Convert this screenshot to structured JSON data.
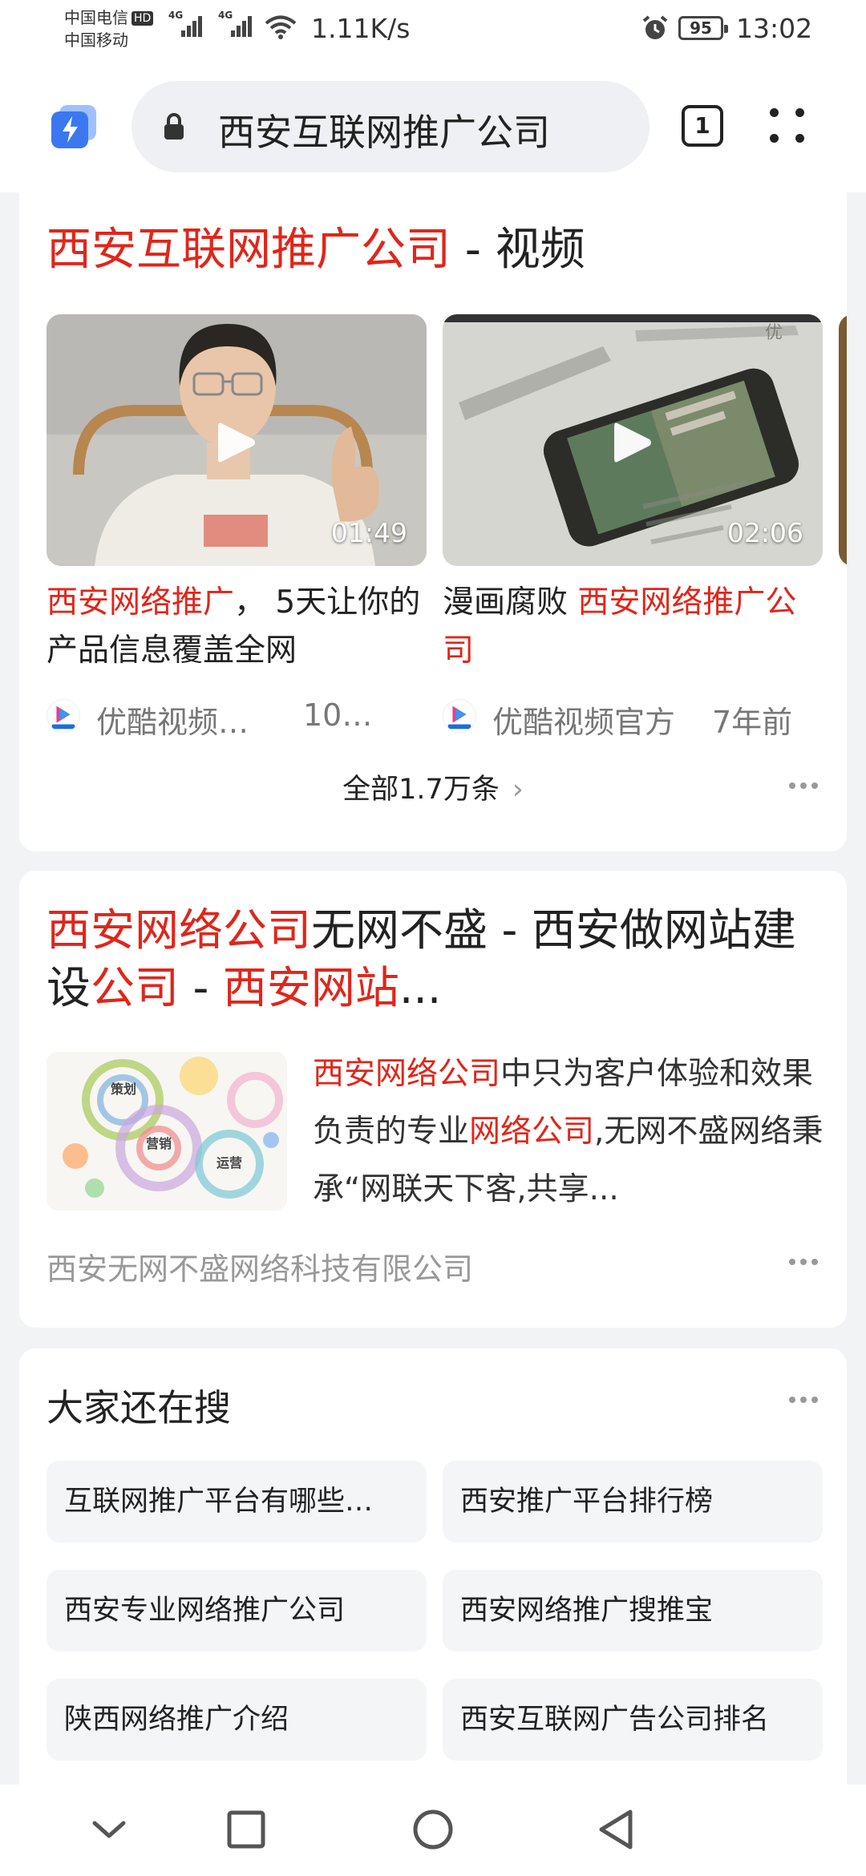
{
  "status": {
    "carrier1": "中国电信",
    "hd": "HD",
    "carrier2": "中国移动",
    "sig1": "4G",
    "sig2": "4G",
    "speed": "1.11K/s",
    "battery": "95",
    "time": "13:02"
  },
  "address": {
    "query": "西安互联网推广公司",
    "tab_count": "1"
  },
  "video_section": {
    "title_red": "西安互联网推广公司",
    "title_rest": " - 视频",
    "videos": [
      {
        "duration": "01:49",
        "title_red": "西安网络推广",
        "title_rest": "， 5天让你的产品信息覆盖全网",
        "source": "优酷视频…",
        "ago": "10…"
      },
      {
        "duration": "02:06",
        "title_pre": "漫画腐败 ",
        "title_red": "西安网络推广公司",
        "source": "优酷视频官方",
        "ago": "7年前"
      }
    ],
    "all_link": "全部1.7万条",
    "chev": "›"
  },
  "result": {
    "t1": "西安网络公司",
    "t2": "无网不盛 - 西安做网站建设",
    "t3": "公司",
    "t4": " - ",
    "t5": "西安网站",
    "t6": "...",
    "s1": "西安网络公司",
    "s2": "中只为客户体验和效果负责的专业",
    "s3": "网络公司",
    "s4": ",无网不盛网络秉承“网联天下客,共享...",
    "source": "西安无网不盛网络科技有限公司",
    "thumb_words": [
      "策划",
      "营销",
      "运营"
    ]
  },
  "also_search": {
    "title": "大家还在搜",
    "items": [
      "互联网推广平台有哪些…",
      "西安推广平台排行榜",
      "西安专业网络推广公司",
      "西安网络推广搜推宝",
      "陕西网络推广介绍",
      "西安互联网广告公司排名"
    ]
  },
  "colors": {
    "highlight": "#e0261a",
    "app_logo": "#3b78f0"
  }
}
